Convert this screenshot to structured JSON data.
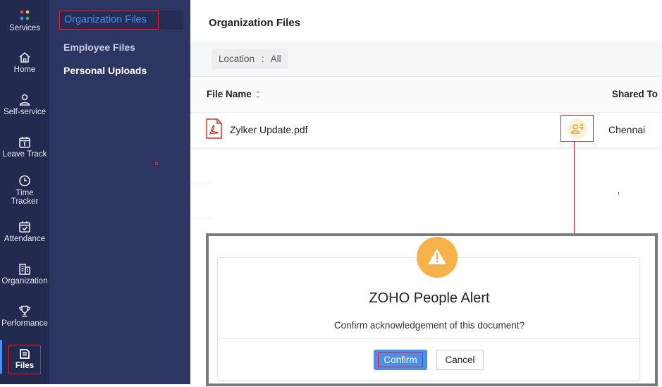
{
  "rail": {
    "items": [
      {
        "label": "Services",
        "icon": "services-icon"
      },
      {
        "label": "Home",
        "icon": "home-icon"
      },
      {
        "label": "Self-service",
        "icon": "user-icon"
      },
      {
        "label": "Leave Track",
        "icon": "calendar-icon"
      },
      {
        "label": "Time Tracker",
        "line1": "Time",
        "line2": "Tracker",
        "icon": "clock-icon"
      },
      {
        "label": "Attendance",
        "icon": "calendar-check-icon"
      },
      {
        "label": "Organization",
        "icon": "building-icon"
      },
      {
        "label": "Performance",
        "icon": "trophy-icon"
      },
      {
        "label": "Files",
        "icon": "files-icon"
      }
    ],
    "active": "Files"
  },
  "sidebar": {
    "items": [
      {
        "label": "Organization Files",
        "active": true
      },
      {
        "label": "Employee Files"
      },
      {
        "label": "Personal Uploads"
      }
    ]
  },
  "main": {
    "title": "Organization Files",
    "filter": {
      "label": "Location",
      "separator": ":",
      "value": "All"
    },
    "columns": {
      "file_name": "File Name",
      "shared_to": "Shared To"
    },
    "rows": [
      {
        "file_name": "Zylker Update.pdf",
        "file_icon": "pdf-icon",
        "share_icon": "user-share-icon",
        "shared_to": "Chennai"
      }
    ]
  },
  "dialog": {
    "title": "ZOHO People Alert",
    "message": "Confirm acknowledgement of this document?",
    "confirm_label": "Confirm",
    "cancel_label": "Cancel",
    "icon": "warning-icon"
  },
  "colors": {
    "rail_bg": "#222a4f",
    "sidebar_bg": "#2d3563",
    "accent": "#4a8cf0",
    "warning": "#f7b24a",
    "confirm_button": "#4d8ee8",
    "pdf_red": "#d93025"
  }
}
